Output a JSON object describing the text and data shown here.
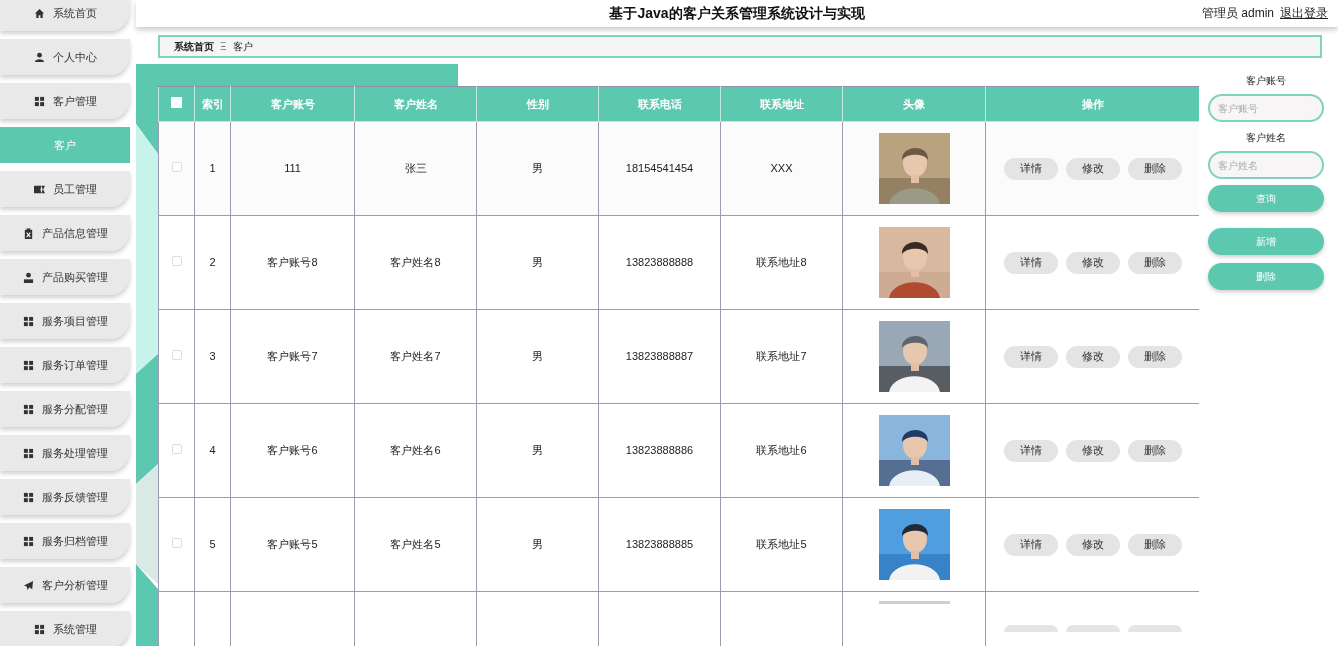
{
  "header": {
    "title": "基于Java的客户关系管理系统设计与实现",
    "user": "管理员 admin",
    "logout": "退出登录"
  },
  "sidebar": {
    "items": [
      {
        "label": "系统首页",
        "kind": "home",
        "selected": false
      },
      {
        "label": "个人中心",
        "kind": "person",
        "selected": false
      },
      {
        "label": "客户管理",
        "kind": "grid",
        "selected": false
      },
      {
        "label": "客户",
        "kind": "plain",
        "selected": true
      },
      {
        "label": "员工管理",
        "kind": "card",
        "selected": false
      },
      {
        "label": "产品信息管理",
        "kind": "clipboard",
        "selected": false
      },
      {
        "label": "产品购买管理",
        "kind": "worker",
        "selected": false
      },
      {
        "label": "服务项目管理",
        "kind": "grid",
        "selected": false
      },
      {
        "label": "服务订单管理",
        "kind": "grid",
        "selected": false
      },
      {
        "label": "服务分配管理",
        "kind": "grid",
        "selected": false
      },
      {
        "label": "服务处理管理",
        "kind": "grid",
        "selected": false
      },
      {
        "label": "服务反馈管理",
        "kind": "grid",
        "selected": false
      },
      {
        "label": "服务归档管理",
        "kind": "grid",
        "selected": false
      },
      {
        "label": "客户分析管理",
        "kind": "plane",
        "selected": false
      },
      {
        "label": "系统管理",
        "kind": "grid",
        "selected": false
      }
    ]
  },
  "breadcrumb": {
    "items": [
      "系统首页",
      "客户"
    ],
    "separator": "Ξ"
  },
  "table": {
    "select_all": {
      "checked": false
    },
    "columns": [
      "索引",
      "客户账号",
      "客户姓名",
      "性别",
      "联系电话",
      "联系地址",
      "头像",
      "操作"
    ],
    "rows": [
      {
        "checked": false,
        "cells": [
          "1",
          "111",
          "张三",
          "男",
          "18154541454",
          "XXX"
        ],
        "actions": [
          "详情",
          "修改",
          "删除"
        ]
      },
      {
        "checked": false,
        "cells": [
          "2",
          "客户账号8",
          "客户姓名8",
          "男",
          "13823888888",
          "联系地址8"
        ],
        "actions": [
          "详情",
          "修改",
          "删除"
        ]
      },
      {
        "checked": false,
        "cells": [
          "3",
          "客户账号7",
          "客户姓名7",
          "男",
          "13823888887",
          "联系地址7"
        ],
        "actions": [
          "详情",
          "修改",
          "删除"
        ]
      },
      {
        "checked": false,
        "cells": [
          "4",
          "客户账号6",
          "客户姓名6",
          "男",
          "13823888886",
          "联系地址6"
        ],
        "actions": [
          "详情",
          "修改",
          "删除"
        ]
      },
      {
        "checked": false,
        "cells": [
          "5",
          "客户账号5",
          "客户姓名5",
          "男",
          "13823888885",
          "联系地址5"
        ],
        "actions": [
          "详情",
          "修改",
          "删除"
        ]
      }
    ],
    "cut_row": true
  },
  "search": {
    "fields": [
      {
        "label": "客户账号",
        "placeholder": "客户账号"
      },
      {
        "label": "客户姓名",
        "placeholder": "客户姓名"
      }
    ],
    "buttons": [
      "查询",
      "新增",
      "删除"
    ]
  }
}
